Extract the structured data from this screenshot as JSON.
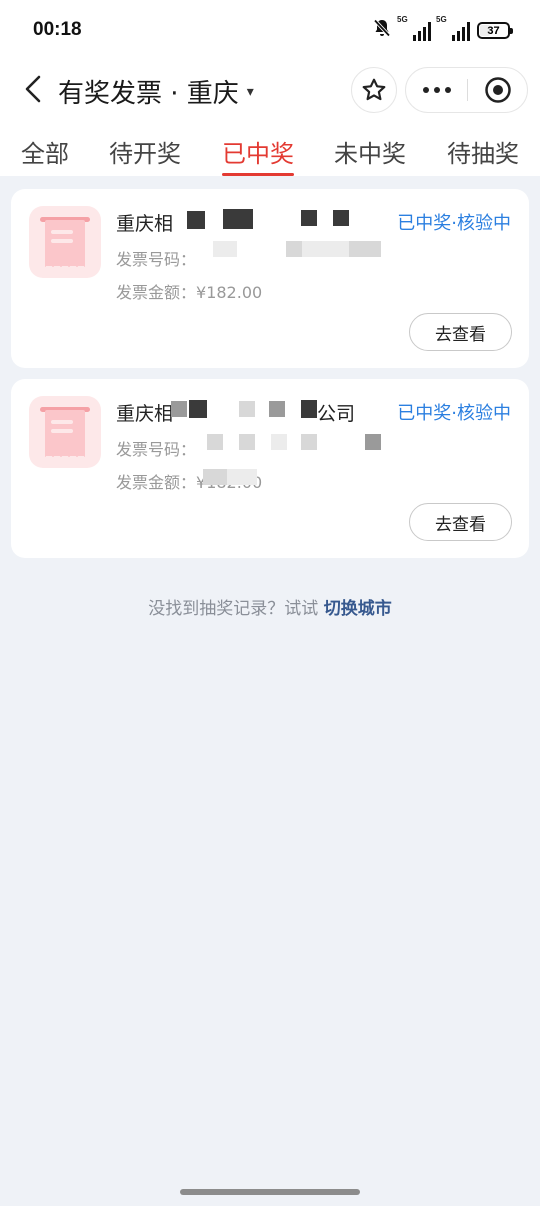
{
  "status_bar": {
    "time": "00:18",
    "signal1_label": "5G",
    "signal2_label": "5G",
    "battery": "37"
  },
  "nav": {
    "title": "有奖发票 · 重庆",
    "caret": "▾"
  },
  "tabs": [
    {
      "label": "全部",
      "active": false
    },
    {
      "label": "待开奖",
      "active": false
    },
    {
      "label": "已中奖",
      "active": true
    },
    {
      "label": "未中奖",
      "active": false
    },
    {
      "label": "待抽奖",
      "active": false
    }
  ],
  "cards": [
    {
      "name": "重庆相",
      "status": "已中奖·核验中",
      "invoice_no_label": "发票号码：",
      "amount_label": "发票金额：",
      "amount_value": "¥182.00",
      "button": "去查看"
    },
    {
      "name": "重庆相",
      "name_suffix": "公司",
      "status": "已中奖·核验中",
      "invoice_no_label": "发票号码：",
      "amount_label": "发票金额：",
      "amount_value": "¥182.00",
      "button": "去查看"
    }
  ],
  "hint": {
    "text": "没找到抽奖记录？试试 ",
    "link": "切换城市"
  },
  "colors": {
    "accent_red": "#e33a32",
    "status_blue": "#2b7fe0",
    "link_blue": "#37598f",
    "background": "#eff2f7"
  },
  "icons": [
    "bell-off-icon",
    "signal-icon",
    "battery-icon",
    "back-arrow-icon",
    "star-icon",
    "more-icon",
    "target-icon",
    "receipt-icon"
  ]
}
